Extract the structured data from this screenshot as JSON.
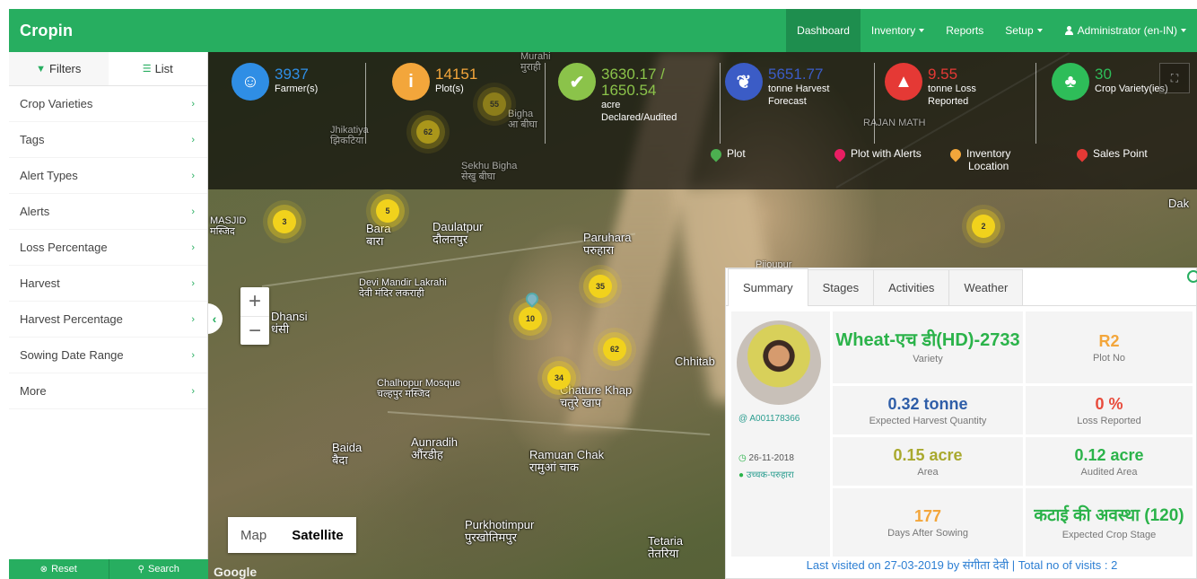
{
  "brand": "Cropin",
  "nav": {
    "dashboard": "Dashboard",
    "inventory": "Inventory",
    "reports": "Reports",
    "setup": "Setup",
    "user": "Administrator (en-IN)"
  },
  "sidebar": {
    "tabs": {
      "filters": "Filters",
      "list": "List"
    },
    "items": [
      "Crop Varieties",
      "Tags",
      "Alert Types",
      "Alerts",
      "Loss Percentage",
      "Harvest",
      "Harvest Percentage",
      "Sowing Date Range",
      "More"
    ],
    "reset": "Reset",
    "search": "Search"
  },
  "stats": {
    "farmers": {
      "value": "3937",
      "label": "Farmer(s)",
      "color": "#2f8ee5"
    },
    "plots": {
      "value": "14151",
      "label": "Plot(s)",
      "color": "#f3a63b"
    },
    "acre": {
      "value": "3630.17 / 1650.54",
      "label1": "acre",
      "label2": "Declared/Audited",
      "color": "#8bc34a"
    },
    "harvest": {
      "value": "5651.77",
      "label1": "tonne Harvest",
      "label2": "Forecast",
      "color": "#3b5cc6"
    },
    "loss": {
      "value": "9.55",
      "label1": "tonne Loss",
      "label2": "Reported",
      "color": "#e53935"
    },
    "variety": {
      "value": "30",
      "label": "Crop Variety(ies)",
      "color": "#2ebd59"
    }
  },
  "legend": {
    "plot": "Plot",
    "plot_alerts": "Plot with Alerts",
    "inventory": "Inventory",
    "inventory2": "Location",
    "sales": "Sales Point"
  },
  "map": {
    "labels": [
      "MASJID",
      "मस्जिद",
      "Bara",
      "बारा",
      "Daulatpur",
      "दौलतपुर",
      "Paruhara",
      "परुहारा",
      "Devi Mandir Lakrahi",
      "देवी मंदिर लकराही",
      "Dhansi",
      "धंसी",
      "Chalhopur Mosque",
      "चल्हपुर मस्जिद",
      "Chature Khap",
      "चतुरे खाप",
      "Baida",
      "बैदा",
      "Aunradih",
      "औंरडीह",
      "Ramuan Chak",
      "रामुआं चाक",
      "Purkhotimpur",
      "पुरखोतिमपुर",
      "Tetaria",
      "तेतरिया",
      "Sekhu Bigha",
      "सेखु बीघा",
      "Jhikatiya",
      "झिकटिया",
      "Dak",
      "RAJAN MATH",
      "Chhitab",
      "Murahi",
      "मुराही",
      "Bigha",
      "आ बीघा",
      "Pijoupur"
    ],
    "clusters": [
      "3",
      "5",
      "62",
      "35",
      "10",
      "62",
      "34",
      "2",
      "55"
    ],
    "zoom_in": "+",
    "zoom_out": "−",
    "type_map": "Map",
    "type_satellite": "Satellite",
    "attribution": "Google"
  },
  "panel": {
    "tabs": [
      "Summary",
      "Stages",
      "Activities",
      "Weather"
    ],
    "variety_value": "Wheat-एच डी(HD)-2733",
    "variety_label": "Variety",
    "plot_no_value": "R2",
    "plot_no_label": "Plot No",
    "harvest_value": "0.32 tonne",
    "harvest_label": "Expected Harvest Quantity",
    "loss_value": "0 %",
    "loss_label": "Loss Reported",
    "area_value": "0.15 acre",
    "area_label": "Area",
    "audited_value": "0.12 acre",
    "audited_label": "Audited Area",
    "days_value": "177",
    "days_label": "Days After Sowing",
    "stage_value": "कटाई की अवस्था (120)",
    "stage_label": "Expected Crop Stage",
    "farmer_id": "@ A001178366",
    "date": "26-11-2018",
    "location": "उच्चक-परुहारा",
    "footer_prefix": "Last visited on 27-03-2019 by संगीता देवी |",
    "footer_visits": "Total no of visits : 2"
  }
}
